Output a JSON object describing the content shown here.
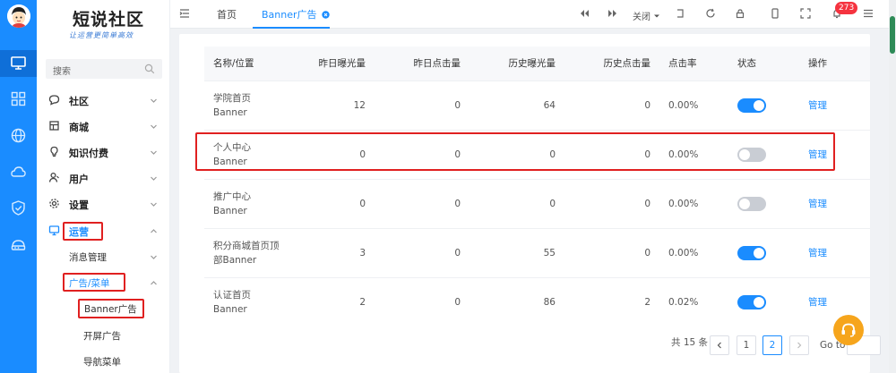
{
  "sidebar": {
    "logo": "短说社区",
    "logo_sub": "让运营更简单高效",
    "search_placeholder": "搜索",
    "menu": [
      {
        "label": "社区",
        "icon": "chat-icon"
      },
      {
        "label": "商城",
        "icon": "store-icon"
      },
      {
        "label": "知识付费",
        "icon": "bulb-icon"
      },
      {
        "label": "用户",
        "icon": "user-icon"
      },
      {
        "label": "设置",
        "icon": "gear-icon"
      },
      {
        "label": "运营",
        "icon": "monitor-icon"
      }
    ],
    "operations_children": {
      "message": "消息管理",
      "ads": "广告/菜单",
      "ads_children": [
        "Banner广告",
        "开屏广告",
        "导航菜单"
      ]
    }
  },
  "topbar": {
    "tabs": [
      "首页",
      "Banner广告"
    ],
    "close_label": "关闭",
    "badge": "273"
  },
  "table": {
    "headers": [
      "名称/位置",
      "昨日曝光量",
      "昨日点击量",
      "历史曝光量",
      "历史点击量",
      "点击率",
      "状态",
      "操作"
    ],
    "rows": [
      {
        "name": "学院首页",
        "position": "Banner",
        "y_exp": "12",
        "y_click": "0",
        "h_exp": "64",
        "h_click": "0",
        "ctr": "0.00%",
        "enabled": true,
        "action": "管理"
      },
      {
        "name": "个人中心",
        "position": "Banner",
        "y_exp": "0",
        "y_click": "0",
        "h_exp": "0",
        "h_click": "0",
        "ctr": "0.00%",
        "enabled": false,
        "action": "管理"
      },
      {
        "name": "推广中心",
        "position": "Banner",
        "y_exp": "0",
        "y_click": "0",
        "h_exp": "0",
        "h_click": "0",
        "ctr": "0.00%",
        "enabled": false,
        "action": "管理"
      },
      {
        "name": "积分商城首页顶",
        "position": "部Banner",
        "y_exp": "3",
        "y_click": "0",
        "h_exp": "55",
        "h_click": "0",
        "ctr": "0.00%",
        "enabled": true,
        "action": "管理"
      },
      {
        "name": "认证首页",
        "position": "Banner",
        "y_exp": "2",
        "y_click": "0",
        "h_exp": "86",
        "h_click": "2",
        "ctr": "0.02%",
        "enabled": true,
        "action": "管理"
      }
    ]
  },
  "pagination": {
    "total": "共 15 条",
    "pages": [
      "1",
      "2"
    ],
    "current": "2",
    "goto": "Go to"
  },
  "colors": {
    "primary": "#1a8cff",
    "highlight": "#e02020",
    "fab": "#f6a51c"
  }
}
